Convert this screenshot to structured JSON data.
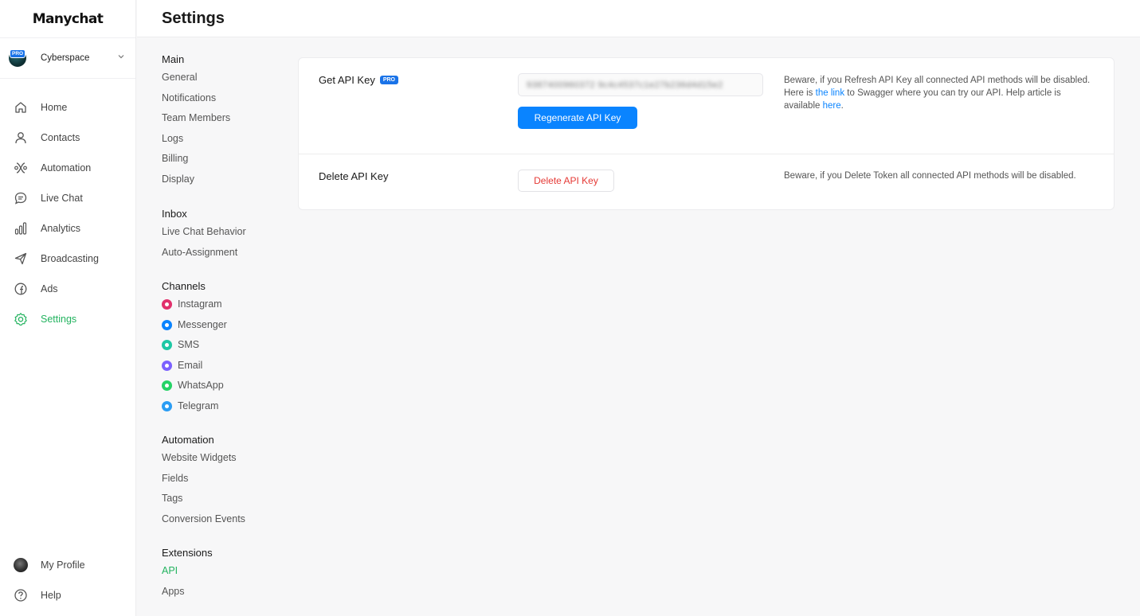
{
  "app": {
    "logo": "Manychat"
  },
  "account": {
    "name": "Cyberspace",
    "badge": "PRO"
  },
  "leftnav": {
    "items": [
      {
        "label": "Home",
        "icon": "home-icon"
      },
      {
        "label": "Contacts",
        "icon": "person-icon"
      },
      {
        "label": "Automation",
        "icon": "automation-icon"
      },
      {
        "label": "Live Chat",
        "icon": "chat-icon"
      },
      {
        "label": "Analytics",
        "icon": "analytics-icon"
      },
      {
        "label": "Broadcasting",
        "icon": "send-icon"
      },
      {
        "label": "Ads",
        "icon": "ads-icon"
      },
      {
        "label": "Settings",
        "icon": "gear-icon",
        "active": true
      }
    ],
    "bottom": [
      {
        "label": "My Profile",
        "icon": "avatar"
      },
      {
        "label": "Help",
        "icon": "help-icon"
      }
    ]
  },
  "header": {
    "title": "Settings"
  },
  "subnav": {
    "main": {
      "title": "Main",
      "items": [
        "General",
        "Notifications",
        "Team Members",
        "Logs",
        "Billing",
        "Display"
      ]
    },
    "inbox": {
      "title": "Inbox",
      "items": [
        "Live Chat Behavior",
        "Auto-Assignment"
      ]
    },
    "channels": {
      "title": "Channels",
      "items": [
        {
          "label": "Instagram",
          "color": "#e1306c"
        },
        {
          "label": "Messenger",
          "color": "#0a84ff"
        },
        {
          "label": "SMS",
          "color": "#1ec8a5"
        },
        {
          "label": "Email",
          "color": "#7b61ff"
        },
        {
          "label": "WhatsApp",
          "color": "#25d366"
        },
        {
          "label": "Telegram",
          "color": "#2a9df4"
        }
      ]
    },
    "automation": {
      "title": "Automation",
      "items": [
        "Website Widgets",
        "Fields",
        "Tags",
        "Conversion Events"
      ]
    },
    "extensions": {
      "title": "Extensions",
      "items": [
        "API",
        "Apps"
      ],
      "active": "API"
    }
  },
  "api_card": {
    "get_key": {
      "label": "Get API Key",
      "badge": "PRO",
      "key_value": "9387400960372 9c4c4537c1e27b236d4d15e2",
      "button": "Regenerate API Key",
      "note_1": "Beware, if you Refresh API Key all connected API methods will be disabled.",
      "note_2_pre": "Here is",
      "note_2_link": "the link",
      "note_2_mid": "to Swagger where you can try our API. Help article is available",
      "note_2_link2": "here",
      "note_2_end": "."
    },
    "delete_key": {
      "label": "Delete API Key",
      "button": "Delete API Key",
      "note": "Beware, if you Delete Token all connected API methods will be disabled."
    }
  },
  "colors": {
    "accent_green": "#23b35f",
    "primary_blue": "#0a84ff",
    "danger_red": "#e53935",
    "pro_blue": "#1a73e8"
  }
}
